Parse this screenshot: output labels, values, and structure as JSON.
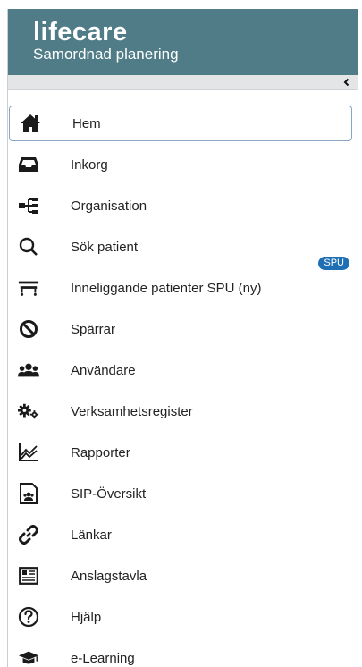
{
  "app": {
    "logo": "lifecare",
    "tagline": "Samordnad planering"
  },
  "colors": {
    "header_bg": "#4f7c86",
    "badge_bg": "#1f6fb4",
    "active_border": "#8aa6c4"
  },
  "collapse": {
    "icon": "chevron-left-icon"
  },
  "nav": {
    "items": [
      {
        "label": "Hem",
        "icon": "home-icon",
        "active": true
      },
      {
        "label": "Inkorg",
        "icon": "inbox-icon"
      },
      {
        "label": "Organisation",
        "icon": "organization-icon"
      },
      {
        "label": "Sök patient",
        "icon": "search-icon"
      },
      {
        "label": "Inneliggande patienter SPU (ny)",
        "icon": "hospital-bed-icon",
        "badge": "SPU"
      },
      {
        "label": "Spärrar",
        "icon": "block-icon"
      },
      {
        "label": "Användare",
        "icon": "users-icon"
      },
      {
        "label": "Verksamhetsregister",
        "icon": "gears-icon"
      },
      {
        "label": "Rapporter",
        "icon": "chart-icon"
      },
      {
        "label": "SIP-Översikt",
        "icon": "document-users-icon"
      },
      {
        "label": "Länkar",
        "icon": "link-icon"
      },
      {
        "label": "Anslagstavla",
        "icon": "notice-board-icon"
      },
      {
        "label": "Hjälp",
        "icon": "help-icon"
      },
      {
        "label": "e-Learning",
        "icon": "graduation-cap-icon"
      }
    ]
  }
}
